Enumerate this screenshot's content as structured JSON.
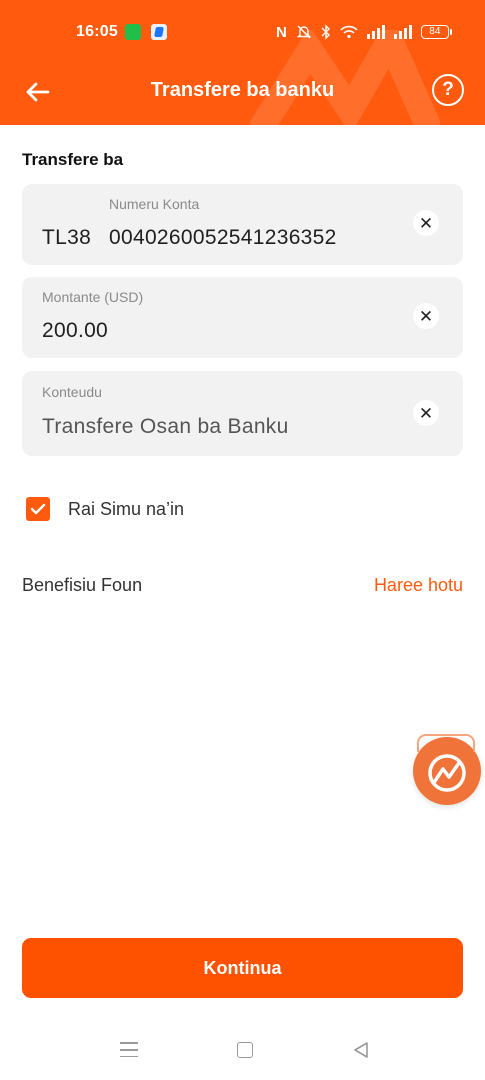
{
  "status_bar": {
    "time": "16:05",
    "nfc": "N",
    "battery": "84"
  },
  "header": {
    "title": "Transfere ba banku",
    "help": "?"
  },
  "form": {
    "section_title": "Transfere ba",
    "account": {
      "label": "Numeru Konta",
      "prefix": "TL38",
      "value": "0040260052541236352"
    },
    "amount": {
      "label": "Montante (USD)",
      "value": "200.00"
    },
    "content": {
      "label": "Konteudu",
      "value": "Transfere Osan ba Banku"
    },
    "save_phone": {
      "label": "Rai Simu na’in",
      "checked": true
    }
  },
  "beneficiaries": {
    "label": "Benefisiu Foun",
    "see_all": "Haree hotu"
  },
  "footer": {
    "continue_label": "Kontinua"
  },
  "colors": {
    "brand": "#ff5a0d",
    "field_bg": "#f2f2f2"
  },
  "icons": [
    "back-arrow-icon",
    "help-icon",
    "clear-icon",
    "check-icon",
    "assistant-bubble-icon",
    "nav-menu-icon",
    "nav-home-icon",
    "nav-back-icon"
  ]
}
